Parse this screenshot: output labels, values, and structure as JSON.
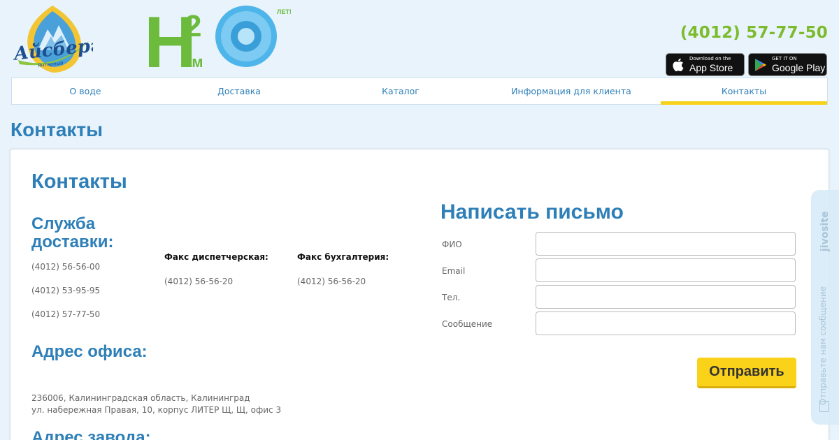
{
  "header": {
    "logo_text": "Айсберг",
    "logo_subtext": "Янтарный",
    "h2o_logo_text": "H",
    "h2o_superscript": "2",
    "h2o_am": "ам",
    "h2o_years": "ЛЕТ!",
    "phone": "(4012) 57-77-50",
    "app_store": {
      "small": "Download on the",
      "big": "App Store"
    },
    "google_play": {
      "small": "GET IT ON",
      "big": "Google Play"
    }
  },
  "nav": {
    "items": [
      {
        "label": "О воде"
      },
      {
        "label": "Доставка"
      },
      {
        "label": "Каталог"
      },
      {
        "label": "Информация для клиента"
      },
      {
        "label": "Контакты"
      }
    ],
    "active_index": 4
  },
  "page": {
    "title": "Контакты"
  },
  "contacts": {
    "title": "Контакты",
    "delivery_heading": "Служба доставки:",
    "delivery_phones": [
      "(4012) 56-56-00",
      "(4012) 53-95-95",
      "(4012) 57-77-50"
    ],
    "fax_dispatch_label": "Факс диспетчерская:",
    "fax_dispatch_value": "(4012) 56-56-20",
    "fax_accounting_label": "Факс бухгалтерия:",
    "fax_accounting_value": "(4012) 56-56-20",
    "office_heading": "Адрес офиса:",
    "office_address_line1": "236006, Калининградская область, Калининград",
    "office_address_line2": "ул. набережная Правая, 10, корпус ЛИТЕР Щ, Щ, офис 3",
    "factory_heading": "Адрес завода:"
  },
  "form": {
    "title": "Написать письмо",
    "fields": [
      {
        "label": "ФИО",
        "value": ""
      },
      {
        "label": "Email",
        "value": ""
      },
      {
        "label": "Тел.",
        "value": ""
      },
      {
        "label": "Сообщение",
        "value": ""
      }
    ],
    "submit_label": "Отправить"
  },
  "jivo": {
    "brand": "jivosite",
    "text": "Отправьте нам сообщение"
  },
  "colors": {
    "accent_blue": "#2e7fb8",
    "phone_green": "#7dbb2e",
    "button_yellow": "#fbd21a",
    "background": "#e8f3fb"
  }
}
